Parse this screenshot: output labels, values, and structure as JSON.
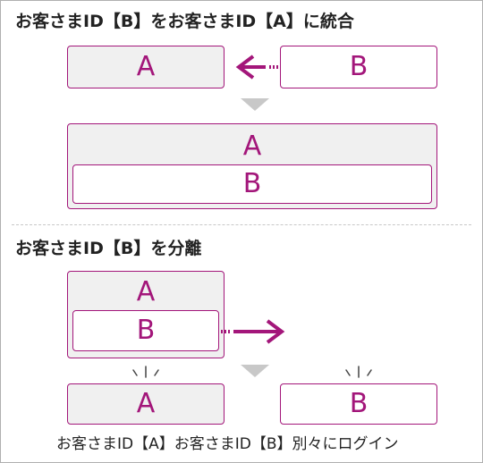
{
  "merge": {
    "heading": "お客さまID【B】をお客さまID【A】に統合",
    "source_id": "A",
    "target_id": "B",
    "result_outer": "A",
    "result_inner": "B"
  },
  "split": {
    "heading": "お客さまID【B】を分離",
    "outer_id": "A",
    "inner_id": "B",
    "result_left": "A",
    "result_right": "B",
    "caption": "お客さまID【A】お客さまID【B】別々にログイン"
  },
  "colors": {
    "accent": "#a3167a",
    "box_fill": "#f0f0f0",
    "arrow_down": "#c8c8c8"
  }
}
